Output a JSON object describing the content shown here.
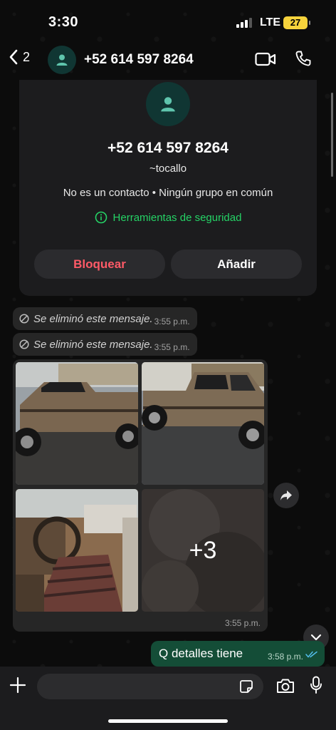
{
  "status": {
    "time": "3:30",
    "network": "LTE",
    "battery": "27"
  },
  "header": {
    "back_count": "2",
    "title": "+52 614 597 8264",
    "icons": [
      "chevron-left-icon",
      "person-icon",
      "video-call-icon",
      "phone-icon"
    ]
  },
  "contact_card": {
    "phone": "+52 614 597 8264",
    "name": "~tocallo",
    "info": "No es un contacto • Ningún grupo en común",
    "safety_tools": "Herramientas de seguridad",
    "block_label": "Bloquear",
    "add_label": "Añadir"
  },
  "messages": {
    "deleted": [
      {
        "text": "Se eliminó este mensaje.",
        "time": "3:55 p.m."
      },
      {
        "text": "Se eliminó este mensaje.",
        "time": "3:55 p.m."
      }
    ],
    "album": {
      "more_count": "+3",
      "time": "3:55 p.m."
    },
    "outgoing": {
      "text": "Q detalles tiene",
      "time": "3:58 p.m."
    }
  },
  "colors": {
    "accent": "#25d366",
    "block": "#ff5a67",
    "outgoing_bubble": "#144d37",
    "incoming_bubble": "#262626",
    "battery": "#f6d33c"
  }
}
